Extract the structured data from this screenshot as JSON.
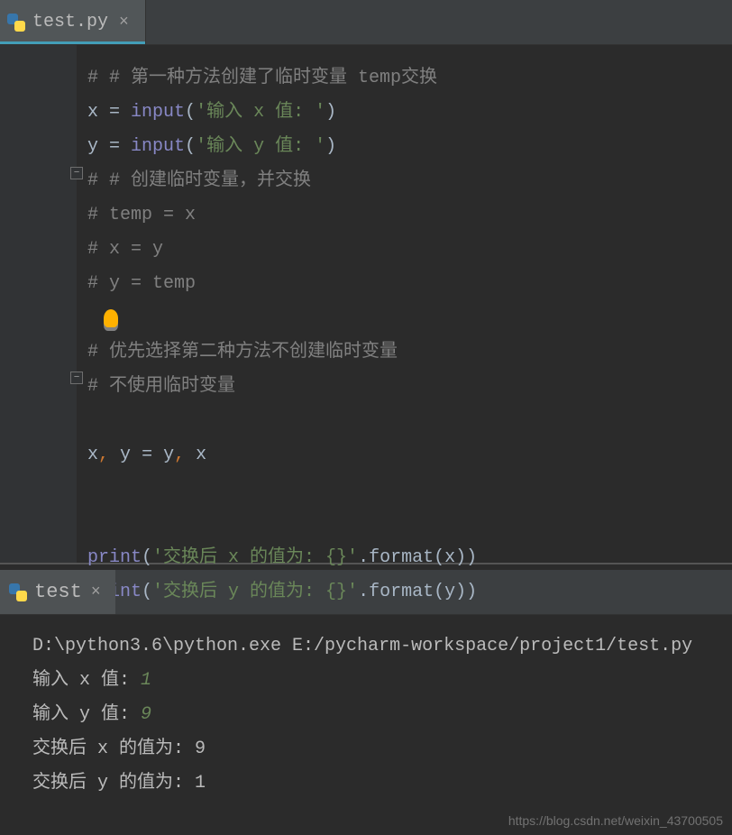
{
  "editorTab": {
    "label": "test.py"
  },
  "code": {
    "lines": [
      {
        "type": "comment",
        "text": "# # 第一种方法创建了临时变量 temp交换"
      },
      {
        "type": "input",
        "var": "x",
        "assign": " = ",
        "fn": "input",
        "open": "(",
        "s": "'输入 x 值: '",
        "close": ")"
      },
      {
        "type": "input",
        "var": "y",
        "assign": " = ",
        "fn": "input",
        "open": "(",
        "s": "'输入 y 值: '",
        "close": ")"
      },
      {
        "type": "comment",
        "text": "# # 创建临时变量，并交换"
      },
      {
        "type": "comment",
        "text": "# temp = x"
      },
      {
        "type": "comment",
        "text": "# x = y"
      },
      {
        "type": "comment",
        "text": "# y = temp"
      },
      {
        "type": "bulb"
      },
      {
        "type": "comment",
        "text": "# 优先选择第二种方法不创建临时变量"
      },
      {
        "type": "comment",
        "text": "# 不使用临时变量"
      },
      {
        "type": "blank"
      },
      {
        "type": "swap",
        "a": "x",
        "c1": ",",
        "sp1": " ",
        "b": "y",
        "eq": " = ",
        "d": "y",
        "c2": ",",
        "sp2": " ",
        "e": "x"
      },
      {
        "type": "blank"
      },
      {
        "type": "blank"
      },
      {
        "type": "print",
        "fn": "print",
        "open": "(",
        "s": "'交换后 x 的值为: {}'",
        "dot": ".",
        "fmt": "format",
        "op2": "(",
        "arg": "x",
        "cl2": ")",
        "close": ")"
      },
      {
        "type": "print",
        "fn": "print",
        "open": "(",
        "s": "'交换后 y 的值为: {}'",
        "dot": ".",
        "fmt": "format",
        "op2": "(",
        "arg": "y",
        "cl2": ")",
        "close": ")"
      }
    ]
  },
  "runTab": {
    "label": "test"
  },
  "console": {
    "lines": [
      {
        "type": "plain",
        "text": "D:\\python3.6\\python.exe E:/pycharm-workspace/project1/test.py"
      },
      {
        "type": "prompt",
        "prompt": "输入 x 值: ",
        "val": "1"
      },
      {
        "type": "prompt",
        "prompt": "输入 y 值: ",
        "val": "9"
      },
      {
        "type": "plain",
        "text": "交换后 x 的值为: 9"
      },
      {
        "type": "plain",
        "text": "交换后 y 的值为: 1"
      }
    ]
  },
  "watermark": "https://blog.csdn.net/weixin_43700505"
}
